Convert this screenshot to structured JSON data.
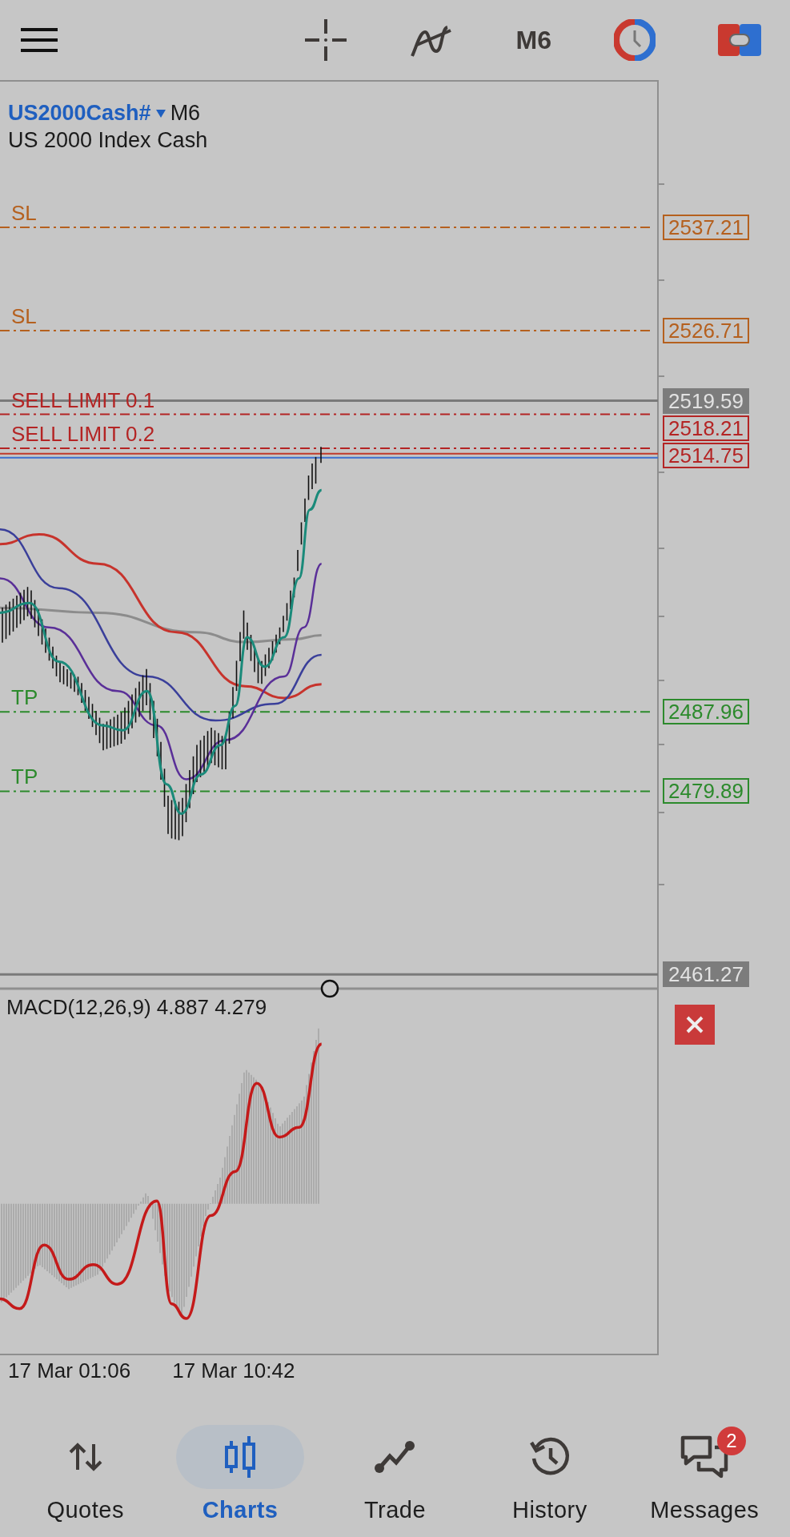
{
  "toolbar": {
    "timeframe": "M6"
  },
  "chart": {
    "symbol": "US2000Cash#",
    "timeframe": "M6",
    "description": "US 2000 Index Cash",
    "levels": [
      {
        "kind": "sl",
        "label": "SL",
        "price": "2537.21"
      },
      {
        "kind": "sl",
        "label": "SL",
        "price": "2526.71"
      },
      {
        "kind": "sell_limit",
        "label": "SELL LIMIT 0.1",
        "price": "2518.21"
      },
      {
        "kind": "sell_limit",
        "label": "SELL LIMIT 0.2",
        "price": "2514.75"
      },
      {
        "kind": "tp",
        "label": "TP",
        "price": "2487.96"
      },
      {
        "kind": "tp",
        "label": "TP",
        "price": "2479.89"
      }
    ],
    "price_lines": [
      {
        "price": "2519.59"
      },
      {
        "price": "2461.27"
      }
    ]
  },
  "indicator": {
    "label": "MACD(12,26,9) 4.887 4.279"
  },
  "time_axis": [
    "17 Mar 01:06",
    "17 Mar 10:42"
  ],
  "nav": [
    {
      "label": "Quotes",
      "selected": false
    },
    {
      "label": "Charts",
      "selected": true
    },
    {
      "label": "Trade",
      "selected": false
    },
    {
      "label": "History",
      "selected": false
    },
    {
      "label": "Messages",
      "selected": false,
      "badge": "2"
    }
  ]
}
